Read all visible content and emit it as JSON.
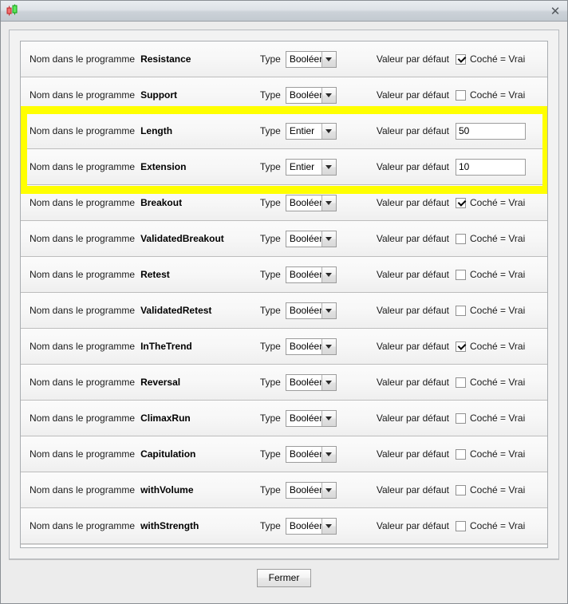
{
  "window": {
    "icon": "candlestick-chart-icon",
    "title": "",
    "close_glyph": "✕"
  },
  "columns": {
    "name_label": "Nom dans le programme",
    "type_label": "Type",
    "default_label": "Valeur par défaut",
    "checkbox_text": "Coché = Vrai"
  },
  "types": {
    "boolean": "Booléen",
    "integer": "Entier"
  },
  "rows": [
    {
      "name": "Resistance",
      "type": "Booléen",
      "kind": "bool",
      "checked": true,
      "check_text": "Coché = Vrai",
      "value": ""
    },
    {
      "name": "Support",
      "type": "Booléen",
      "kind": "bool",
      "checked": false,
      "check_text": "Coché = Vrai",
      "value": ""
    },
    {
      "name": "Length",
      "type": "Entier",
      "kind": "int",
      "checked": false,
      "check_text": "",
      "value": "50"
    },
    {
      "name": "Extension",
      "type": "Entier",
      "kind": "int",
      "checked": false,
      "check_text": "",
      "value": "10"
    },
    {
      "name": "Breakout",
      "type": "Booléen",
      "kind": "bool",
      "checked": true,
      "check_text": "Coché = Vrai",
      "value": ""
    },
    {
      "name": "ValidatedBreakout",
      "type": "Booléen",
      "kind": "bool",
      "checked": false,
      "check_text": "Coché = Vrai",
      "value": ""
    },
    {
      "name": "Retest",
      "type": "Booléen",
      "kind": "bool",
      "checked": false,
      "check_text": "Coché = Vrai",
      "value": ""
    },
    {
      "name": "ValidatedRetest",
      "type": "Booléen",
      "kind": "bool",
      "checked": false,
      "check_text": "Coché = Vrai",
      "value": ""
    },
    {
      "name": "InTheTrend",
      "type": "Booléen",
      "kind": "bool",
      "checked": true,
      "check_text": "Coché = Vrai",
      "value": ""
    },
    {
      "name": "Reversal",
      "type": "Booléen",
      "kind": "bool",
      "checked": false,
      "check_text": "Coché = Vrai",
      "value": ""
    },
    {
      "name": "ClimaxRun",
      "type": "Booléen",
      "kind": "bool",
      "checked": false,
      "check_text": "Coché = Vrai",
      "value": ""
    },
    {
      "name": "Capitulation",
      "type": "Booléen",
      "kind": "bool",
      "checked": false,
      "check_text": "Coché = Vrai",
      "value": ""
    },
    {
      "name": "withVolume",
      "type": "Booléen",
      "kind": "bool",
      "checked": false,
      "check_text": "Coché = Vrai",
      "value": ""
    },
    {
      "name": "withStrength",
      "type": "Booléen",
      "kind": "bool",
      "checked": false,
      "check_text": "Coché = Vrai",
      "value": ""
    }
  ],
  "highlight": {
    "color": "#ffff00",
    "rows": [
      "Length",
      "Extension"
    ]
  },
  "footer": {
    "close_label": "Fermer"
  }
}
